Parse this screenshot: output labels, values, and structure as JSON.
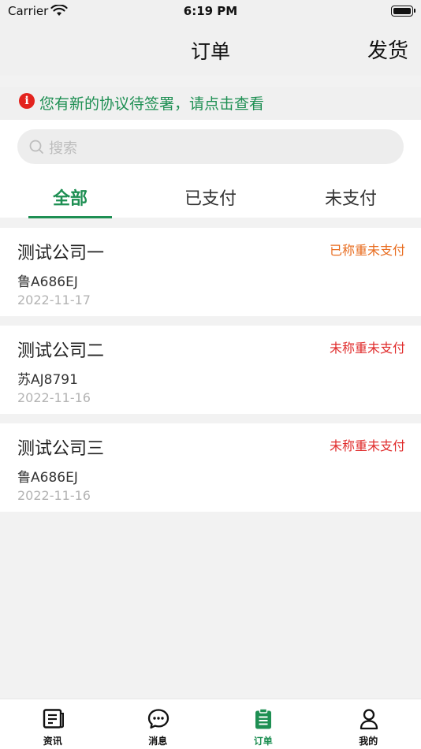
{
  "status_bar": {
    "carrier": "Carrier",
    "time": "6:19 PM"
  },
  "nav": {
    "title": "订单",
    "action": "发货"
  },
  "notice": {
    "icon_glyph": "i",
    "text": "您有新的协议待签署，请点击查看"
  },
  "search": {
    "placeholder": "搜索"
  },
  "tabs": [
    {
      "label": "全部",
      "active": true
    },
    {
      "label": "已支付",
      "active": false
    },
    {
      "label": "未支付",
      "active": false
    }
  ],
  "orders": [
    {
      "company": "测试公司一",
      "status": "已称重未支付",
      "status_color": "#e86c1f",
      "plate": "鲁A686EJ",
      "date": "2022-11-17"
    },
    {
      "company": "测试公司二",
      "status": "未称重未支付",
      "status_color": "#e02c2c",
      "plate": "苏AJ8791",
      "date": "2022-11-16"
    },
    {
      "company": "测试公司三",
      "status": "未称重未支付",
      "status_color": "#e02c2c",
      "plate": "鲁A686EJ",
      "date": "2022-11-16"
    }
  ],
  "tab_bar": [
    {
      "label": "资讯",
      "icon": "news-icon",
      "active": false
    },
    {
      "label": "消息",
      "icon": "chat-icon",
      "active": false
    },
    {
      "label": "订单",
      "icon": "clipboard-icon",
      "active": true
    },
    {
      "label": "我的",
      "icon": "user-icon",
      "active": false
    }
  ],
  "colors": {
    "brand": "#1e8f53",
    "alert": "#e3231e",
    "weighed": "#e86c1f",
    "unweighed": "#e02c2c"
  }
}
